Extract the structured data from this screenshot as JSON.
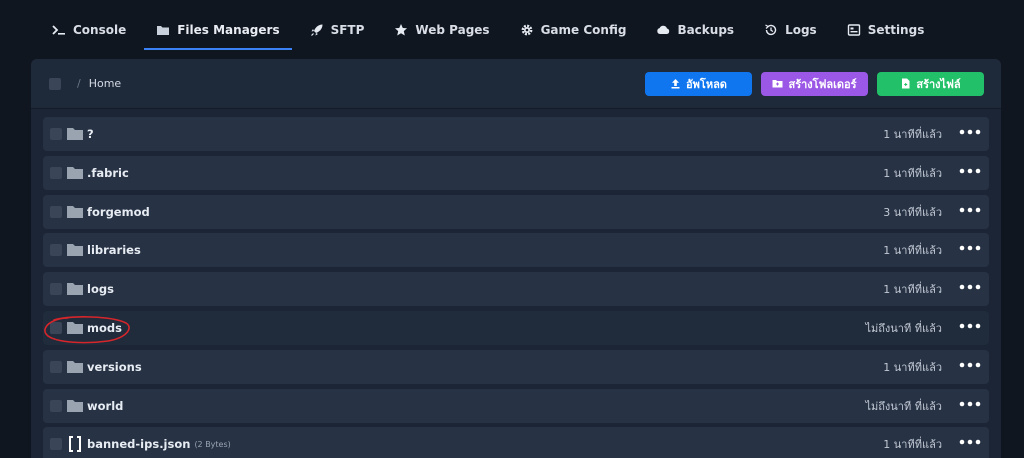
{
  "nav": {
    "items": [
      {
        "label": "Console",
        "icon": "terminal-icon",
        "active": false
      },
      {
        "label": "Files Managers",
        "icon": "folder-icon",
        "active": true
      },
      {
        "label": "SFTP",
        "icon": "rocket-icon",
        "active": false
      },
      {
        "label": "Web Pages",
        "icon": "star-icon",
        "active": false
      },
      {
        "label": "Game Config",
        "icon": "gear-icon",
        "active": false
      },
      {
        "label": "Backups",
        "icon": "cloud-icon",
        "active": false
      },
      {
        "label": "Logs",
        "icon": "history-icon",
        "active": false
      },
      {
        "label": "Settings",
        "icon": "settings-panel-icon",
        "active": false
      }
    ]
  },
  "toolbar": {
    "breadcrumb_separator": "/",
    "breadcrumb_current": "Home",
    "upload_label": "อัพโหลด",
    "new_folder_label": "สร้างโฟลเดอร์",
    "new_file_label": "สร้างไฟล์"
  },
  "files": [
    {
      "name": "?",
      "type": "folder",
      "size": "",
      "modified": "1 นาทีที่แล้ว"
    },
    {
      "name": ".fabric",
      "type": "folder",
      "size": "",
      "modified": "1 นาทีที่แล้ว"
    },
    {
      "name": "forgemod",
      "type": "folder",
      "size": "",
      "modified": "3 นาทีที่แล้ว"
    },
    {
      "name": "libraries",
      "type": "folder",
      "size": "",
      "modified": "1 นาทีที่แล้ว"
    },
    {
      "name": "logs",
      "type": "folder",
      "size": "",
      "modified": "1 นาทีที่แล้ว"
    },
    {
      "name": "mods",
      "type": "folder",
      "size": "",
      "modified": "ไม่ถึงนาที ที่แล้ว"
    },
    {
      "name": "versions",
      "type": "folder",
      "size": "",
      "modified": "1 นาทีที่แล้ว"
    },
    {
      "name": "world",
      "type": "folder",
      "size": "",
      "modified": "ไม่ถึงนาที ที่แล้ว"
    },
    {
      "name": "banned-ips.json",
      "type": "file",
      "size": "(2 Bytes)",
      "modified": "1 นาทีที่แล้ว"
    }
  ],
  "colors": {
    "accent": "#3b82f6",
    "upload": "#0f76f0",
    "new_folder": "#9b57e6",
    "new_file": "#22c068",
    "annotation": "#d6262b"
  }
}
